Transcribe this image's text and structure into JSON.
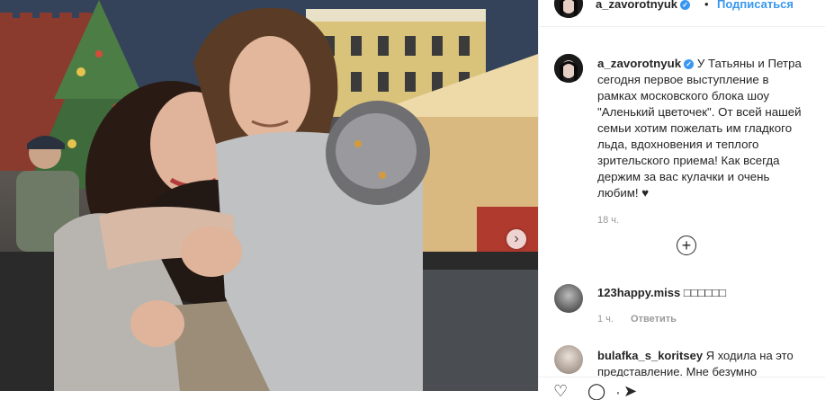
{
  "header": {
    "username": "a_zavorotnyuk",
    "separator": "•",
    "follow_label": "Подписаться"
  },
  "caption": {
    "username": "a_zavorotnyuk",
    "text": "У Татьяны и Петра сегодня первое выступление в рамках московского блока шоу \"Аленький цветочек\". От всей нашей семьи хотим пожелать им гладкого льда, вдохновения и теплого зрительского приема! Как всегда держим за вас кулачки и очень любим! ♥",
    "time": "18 ч."
  },
  "add_comment_icon": "plus-circle-icon",
  "comments": [
    {
      "username": "123happy.miss",
      "text": "□□□□□□",
      "time": "1 ч.",
      "reply_label": "Ответить"
    },
    {
      "username": "bulafka_s_koritsey",
      "text": "Я ходила на это представление. Мне безумно понравилось"
    }
  ],
  "icons": {
    "next": "chevron-right-icon",
    "verified": "verified-badge-icon",
    "like": "heart-icon",
    "comment": "comment-icon",
    "share": "share-icon"
  },
  "colors": {
    "link": "#3897f0",
    "text": "#262626",
    "muted": "#999999",
    "border": "#efefef"
  }
}
